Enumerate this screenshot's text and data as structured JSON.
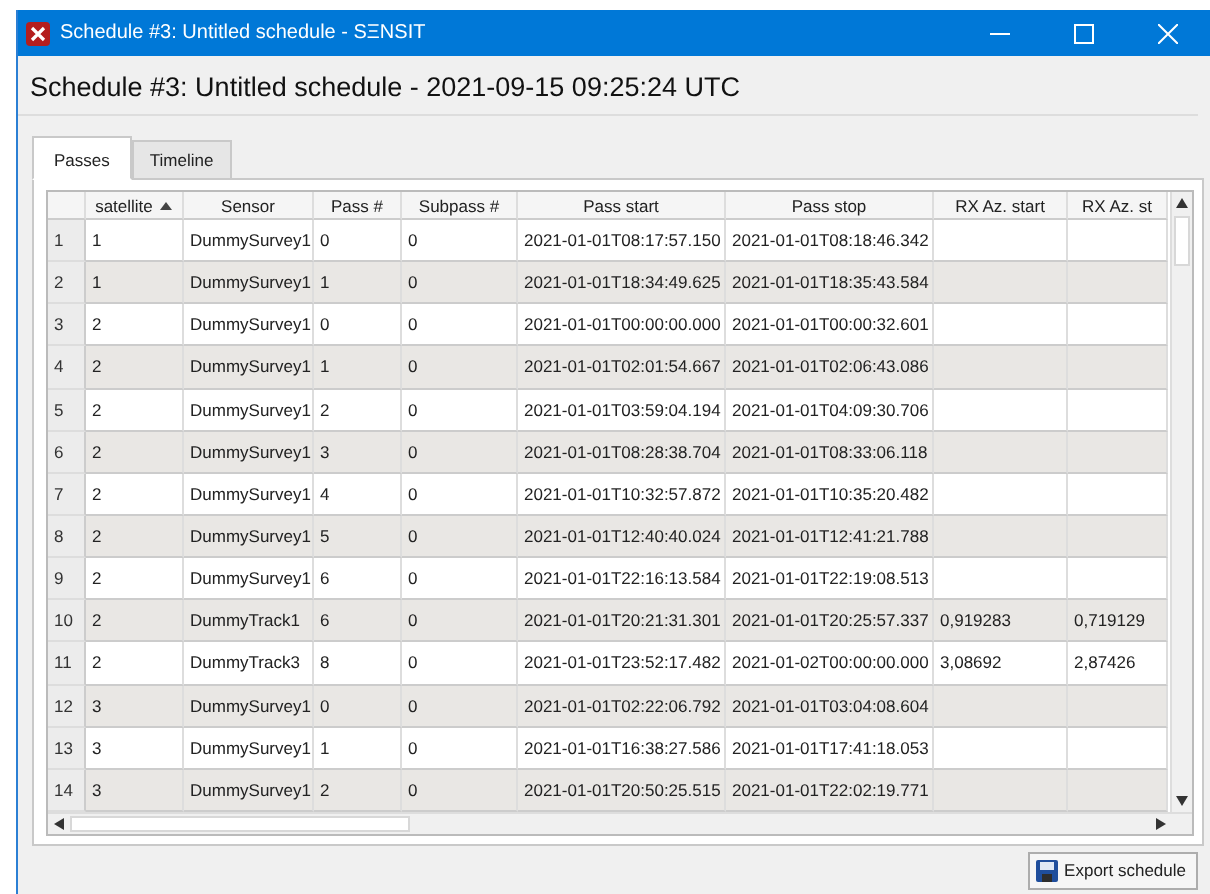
{
  "window": {
    "title": "Schedule #3: Untitled schedule - SΞNSIT"
  },
  "heading": "Schedule #3: Untitled schedule - 2021-09-15 09:25:24 UTC",
  "tabs": [
    {
      "label": "Passes",
      "selected": true
    },
    {
      "label": "Timeline",
      "selected": false
    }
  ],
  "table": {
    "columns": [
      {
        "label": "satellite",
        "sorted": true
      },
      {
        "label": "Sensor",
        "sorted": false
      },
      {
        "label": "Pass #",
        "sorted": false
      },
      {
        "label": "Subpass #",
        "sorted": false
      },
      {
        "label": "Pass start",
        "sorted": false
      },
      {
        "label": "Pass stop",
        "sorted": false
      },
      {
        "label": "RX Az. start",
        "sorted": false
      },
      {
        "label": "RX Az. st",
        "sorted": false
      }
    ],
    "rows": [
      {
        "number": "1",
        "cells": [
          "1",
          "DummySurvey1",
          "0",
          "0",
          "2021-01-01T08:17:57.150",
          "2021-01-01T08:18:46.342",
          "",
          ""
        ]
      },
      {
        "number": "2",
        "cells": [
          "1",
          "DummySurvey1",
          "1",
          "0",
          "2021-01-01T18:34:49.625",
          "2021-01-01T18:35:43.584",
          "",
          ""
        ]
      },
      {
        "number": "3",
        "cells": [
          "2",
          "DummySurvey1",
          "0",
          "0",
          "2021-01-01T00:00:00.000",
          "2021-01-01T00:00:32.601",
          "",
          ""
        ]
      },
      {
        "number": "4",
        "cells": [
          "2",
          "DummySurvey1",
          "1",
          "0",
          "2021-01-01T02:01:54.667",
          "2021-01-01T02:06:43.086",
          "",
          ""
        ]
      },
      {
        "number": "5",
        "cells": [
          "2",
          "DummySurvey1",
          "2",
          "0",
          "2021-01-01T03:59:04.194",
          "2021-01-01T04:09:30.706",
          "",
          ""
        ]
      },
      {
        "number": "6",
        "cells": [
          "2",
          "DummySurvey1",
          "3",
          "0",
          "2021-01-01T08:28:38.704",
          "2021-01-01T08:33:06.118",
          "",
          ""
        ]
      },
      {
        "number": "7",
        "cells": [
          "2",
          "DummySurvey1",
          "4",
          "0",
          "2021-01-01T10:32:57.872",
          "2021-01-01T10:35:20.482",
          "",
          ""
        ]
      },
      {
        "number": "8",
        "cells": [
          "2",
          "DummySurvey1",
          "5",
          "0",
          "2021-01-01T12:40:40.024",
          "2021-01-01T12:41:21.788",
          "",
          ""
        ]
      },
      {
        "number": "9",
        "cells": [
          "2",
          "DummySurvey1",
          "6",
          "0",
          "2021-01-01T22:16:13.584",
          "2021-01-01T22:19:08.513",
          "",
          ""
        ]
      },
      {
        "number": "10",
        "cells": [
          "2",
          "DummyTrack1",
          "6",
          "0",
          "2021-01-01T20:21:31.301",
          "2021-01-01T20:25:57.337",
          "0,919283",
          "0,719129"
        ]
      },
      {
        "number": "11",
        "cells": [
          "2",
          "DummyTrack3",
          "8",
          "0",
          "2021-01-01T23:52:17.482",
          "2021-01-02T00:00:00.000",
          "3,08692",
          "2,87426"
        ]
      },
      {
        "number": "12",
        "cells": [
          "3",
          "DummySurvey1",
          "0",
          "0",
          "2021-01-01T02:22:06.792",
          "2021-01-01T03:04:08.604",
          "",
          ""
        ]
      },
      {
        "number": "13",
        "cells": [
          "3",
          "DummySurvey1",
          "1",
          "0",
          "2021-01-01T16:38:27.586",
          "2021-01-01T17:41:18.053",
          "",
          ""
        ]
      },
      {
        "number": "14",
        "cells": [
          "3",
          "DummySurvey1",
          "2",
          "0",
          "2021-01-01T20:50:25.515",
          "2021-01-01T22:02:19.771",
          "",
          ""
        ]
      }
    ]
  },
  "export_button": {
    "label": "Export schedule"
  }
}
